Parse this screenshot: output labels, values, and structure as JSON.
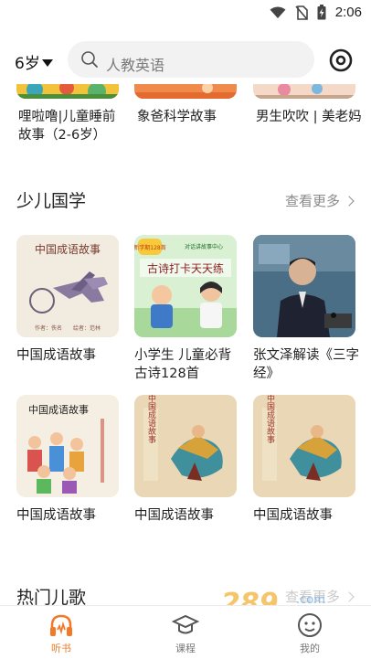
{
  "status": {
    "time": "2:06"
  },
  "header": {
    "age": "6岁",
    "search_placeholder": "人教英语"
  },
  "top_row": [
    {
      "title": "哩啦噜|儿童睡前故事（2-6岁）"
    },
    {
      "title": "象爸科学故事"
    },
    {
      "title": "男生吹吹 | 美老妈"
    }
  ],
  "section_guoxue": {
    "title": "少儿国学",
    "more": "查看更多",
    "items": [
      {
        "title": "中国成语故事",
        "cover_text": "中国成语故事",
        "cover_sub1": "作者：佚名",
        "cover_sub2": "绘者：范林"
      },
      {
        "title": "小学生 儿童必背古诗128首",
        "cover_text": "古诗打卡天天练",
        "cover_badge": "新学期128首",
        "cover_sub1": "对话讲故事中心"
      },
      {
        "title": "张文泽解读《三字经》"
      },
      {
        "title": "中国成语故事",
        "cover_text": "中国成语故事"
      },
      {
        "title": "中国成语故事",
        "cover_text": "中国成语故事"
      },
      {
        "title": "中国成语故事",
        "cover_text": "中国成语故事"
      }
    ]
  },
  "section_hot": {
    "title": "热门儿歌",
    "more": "查看更多"
  },
  "bottom_nav": [
    {
      "label": "听书",
      "active": true
    },
    {
      "label": "课程",
      "active": false
    },
    {
      "label": "我的",
      "active": false
    }
  ],
  "watermark": {
    "text": "289",
    "sub": "手游网",
    "domain": "com"
  },
  "colors": {
    "accent": "#f07a2a",
    "text": "#222222",
    "muted": "#8a8a8a",
    "search_bg": "#f2f2f2"
  }
}
